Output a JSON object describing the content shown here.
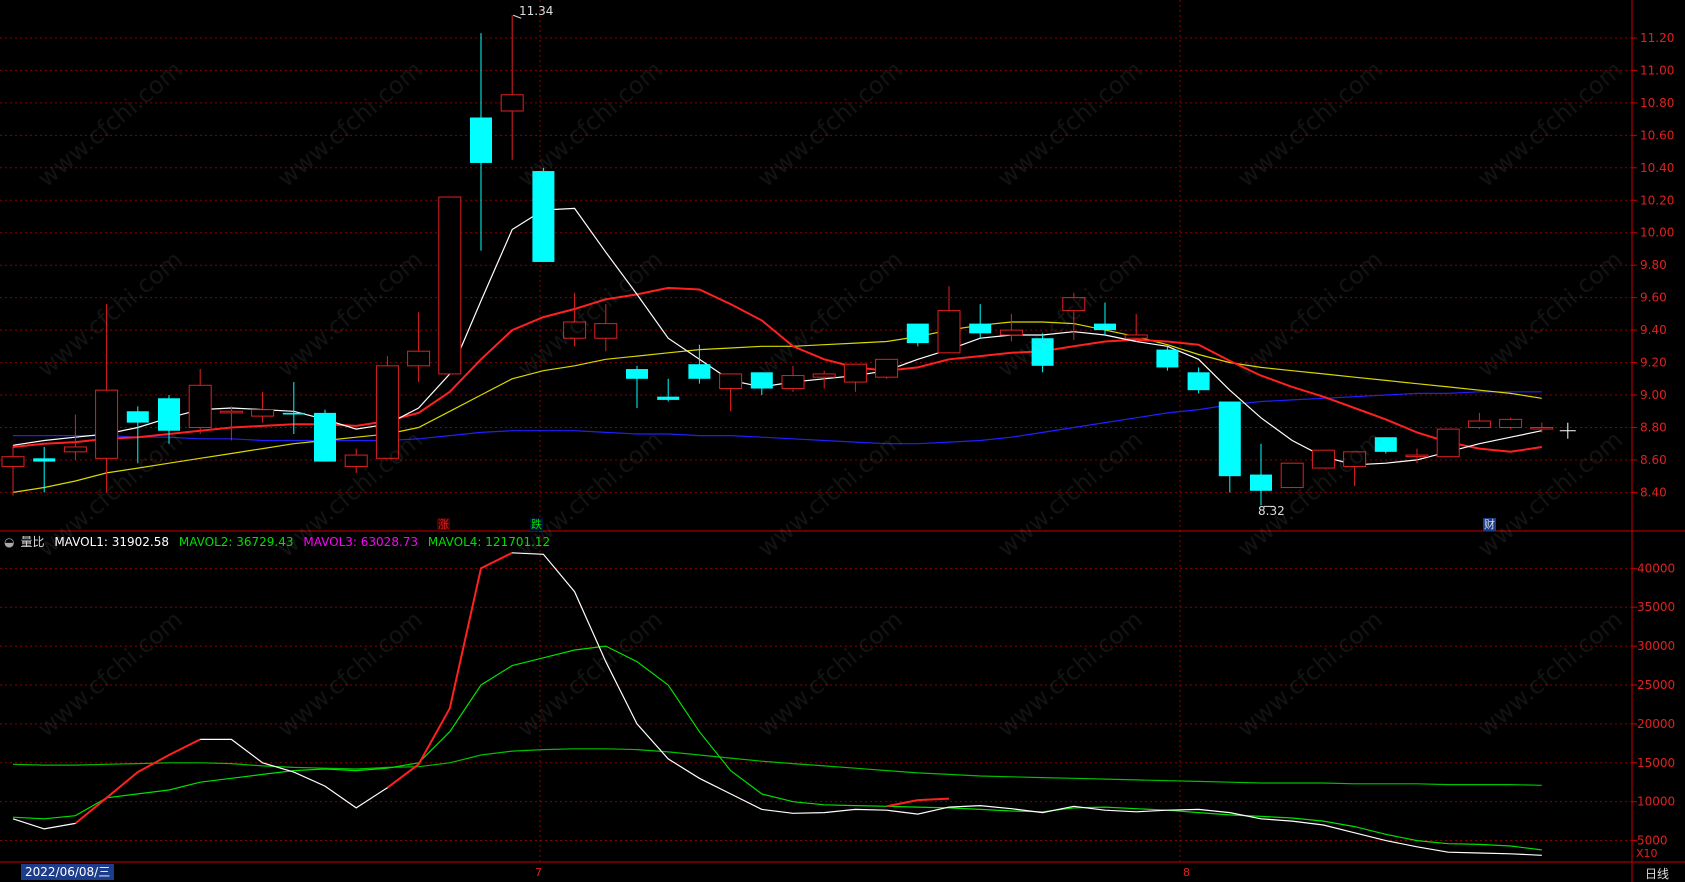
{
  "watermark": "www.cfchi.com",
  "colors": {
    "up": "#e02020",
    "down": "#00ffff",
    "ma5": "#ffffff",
    "ma10": "#ff2020",
    "ma20": "#d8d800",
    "ma60": "#2020ff",
    "mavol1": "#ffffff",
    "mavol2": "#00e000",
    "mavol3": "#ff00ff",
    "mavol4": "#00c000",
    "grid": "#8b0000",
    "axis": "#cc0000"
  },
  "price_axis": {
    "ticks": [
      "11.20",
      "11.00",
      "10.80",
      "10.60",
      "10.40",
      "10.20",
      "10.00",
      "9.80",
      "9.60",
      "9.40",
      "9.20",
      "9.00",
      "8.80",
      "8.60",
      "8.40"
    ],
    "min": 8.23,
    "max": 11.36
  },
  "volume_axis": {
    "ticks": [
      "40000",
      "35000",
      "30000",
      "25000",
      "20000",
      "15000",
      "10000",
      "5000"
    ],
    "unit": "X10",
    "min": 2500,
    "max": 43000
  },
  "annotations": {
    "high": "11.34",
    "low": "8.32"
  },
  "markers": {
    "zhang": "涨",
    "die": "跌",
    "cai": "财"
  },
  "volume_legend": {
    "name": "量比",
    "mavol1": "MAVOL1: 31902.58",
    "mavol2": "MAVOL2: 36729.43",
    "mavol3": "MAVOL3: 63028.73",
    "mavol4": "MAVOL4: 121701.12"
  },
  "bottom_bar": {
    "date": "2022/06/08/三",
    "months": [
      "7",
      "8"
    ],
    "period": "日线"
  },
  "chart_data": {
    "type": "candlestick",
    "candles": [
      {
        "o": 8.56,
        "c": 8.62,
        "h": 8.69,
        "l": 8.38
      },
      {
        "o": 8.61,
        "c": 8.59,
        "h": 8.68,
        "l": 8.4
      },
      {
        "o": 8.65,
        "c": 8.68,
        "h": 8.88,
        "l": 8.6
      },
      {
        "o": 8.61,
        "c": 9.03,
        "h": 9.56,
        "l": 8.4
      },
      {
        "o": 8.9,
        "c": 8.83,
        "h": 8.93,
        "l": 8.58
      },
      {
        "o": 8.98,
        "c": 8.78,
        "h": 9.0,
        "l": 8.7
      },
      {
        "o": 8.8,
        "c": 9.06,
        "h": 9.16,
        "l": 8.76
      },
      {
        "o": 8.89,
        "c": 8.9,
        "h": 8.93,
        "l": 8.72
      },
      {
        "o": 8.87,
        "c": 8.91,
        "h": 9.02,
        "l": 8.83
      },
      {
        "o": 8.89,
        "c": 8.88,
        "h": 9.08,
        "l": 8.76
      },
      {
        "o": 8.89,
        "c": 8.59,
        "h": 8.91,
        "l": 8.59
      },
      {
        "o": 8.56,
        "c": 8.63,
        "h": 8.67,
        "l": 8.52
      },
      {
        "o": 8.61,
        "c": 9.18,
        "h": 9.24,
        "l": 8.61
      },
      {
        "o": 9.18,
        "c": 9.27,
        "h": 9.51,
        "l": 9.08
      },
      {
        "o": 9.13,
        "c": 10.22,
        "h": 10.22,
        "l": 9.13
      },
      {
        "o": 10.71,
        "c": 10.43,
        "h": 11.23,
        "l": 9.89
      },
      {
        "o": 10.75,
        "c": 10.85,
        "h": 11.34,
        "l": 10.45
      },
      {
        "o": 10.38,
        "c": 9.82,
        "h": 10.4,
        "l": 9.82
      },
      {
        "o": 9.35,
        "c": 9.45,
        "h": 9.63,
        "l": 9.3
      },
      {
        "o": 9.35,
        "c": 9.44,
        "h": 9.56,
        "l": 9.27
      },
      {
        "o": 9.16,
        "c": 9.1,
        "h": 9.18,
        "l": 8.92
      },
      {
        "o": 8.99,
        "c": 8.97,
        "h": 9.1,
        "l": 8.96
      },
      {
        "o": 9.19,
        "c": 9.1,
        "h": 9.31,
        "l": 9.07
      },
      {
        "o": 9.04,
        "c": 9.13,
        "h": 9.13,
        "l": 8.9
      },
      {
        "o": 9.14,
        "c": 9.04,
        "h": 9.14,
        "l": 9.0
      },
      {
        "o": 9.04,
        "c": 9.12,
        "h": 9.18,
        "l": 9.02
      },
      {
        "o": 9.11,
        "c": 9.13,
        "h": 9.15,
        "l": 9.04
      },
      {
        "o": 9.08,
        "c": 9.19,
        "h": 9.19,
        "l": 9.02
      },
      {
        "o": 9.11,
        "c": 9.22,
        "h": 9.22,
        "l": 9.1
      },
      {
        "o": 9.44,
        "c": 9.32,
        "h": 9.44,
        "l": 9.3
      },
      {
        "o": 9.26,
        "c": 9.52,
        "h": 9.67,
        "l": 9.26
      },
      {
        "o": 9.44,
        "c": 9.38,
        "h": 9.56,
        "l": 9.35
      },
      {
        "o": 9.37,
        "c": 9.4,
        "h": 9.5,
        "l": 9.33
      },
      {
        "o": 9.35,
        "c": 9.18,
        "h": 9.38,
        "l": 9.14
      },
      {
        "o": 9.52,
        "c": 9.6,
        "h": 9.63,
        "l": 9.34
      },
      {
        "o": 9.44,
        "c": 9.4,
        "h": 9.57,
        "l": 9.37
      },
      {
        "o": 9.35,
        "c": 9.37,
        "h": 9.5,
        "l": 9.33
      },
      {
        "o": 9.28,
        "c": 9.17,
        "h": 9.3,
        "l": 9.15
      },
      {
        "o": 9.14,
        "c": 9.03,
        "h": 9.17,
        "l": 9.01
      },
      {
        "o": 8.96,
        "c": 8.5,
        "h": 8.96,
        "l": 8.4
      },
      {
        "o": 8.51,
        "c": 8.41,
        "h": 8.7,
        "l": 8.32
      },
      {
        "o": 8.43,
        "c": 8.58,
        "h": 8.58,
        "l": 8.43
      },
      {
        "o": 8.55,
        "c": 8.66,
        "h": 8.66,
        "l": 8.55
      },
      {
        "o": 8.56,
        "c": 8.65,
        "h": 8.65,
        "l": 8.44
      },
      {
        "o": 8.74,
        "c": 8.65,
        "h": 8.74,
        "l": 8.64
      },
      {
        "o": 8.63,
        "c": 8.63,
        "h": 8.67,
        "l": 8.58
      },
      {
        "o": 8.62,
        "c": 8.79,
        "h": 8.79,
        "l": 8.62
      },
      {
        "o": 8.8,
        "c": 8.84,
        "h": 8.89,
        "l": 8.79
      },
      {
        "o": 8.8,
        "c": 8.85,
        "h": 8.86,
        "l": 8.79
      },
      {
        "o": 8.8,
        "c": 8.8,
        "h": 8.83,
        "l": 8.77
      }
    ],
    "ma5": [
      8.69,
      8.72,
      8.74,
      8.76,
      8.8,
      8.86,
      8.91,
      8.92,
      8.91,
      8.9,
      8.85,
      8.79,
      8.82,
      8.92,
      9.13,
      9.58,
      10.02,
      10.14,
      10.15,
      9.88,
      9.62,
      9.35,
      9.22,
      9.09,
      9.05,
      9.08,
      9.1,
      9.12,
      9.15,
      9.22,
      9.28,
      9.35,
      9.37,
      9.37,
      9.39,
      9.37,
      9.33,
      9.3,
      9.22,
      9.03,
      8.86,
      8.72,
      8.62,
      8.57,
      8.58,
      8.6,
      8.65,
      8.7,
      8.74,
      8.78
    ],
    "ma10": [
      8.68,
      8.7,
      8.71,
      8.73,
      8.74,
      8.76,
      8.78,
      8.8,
      8.81,
      8.82,
      8.82,
      8.81,
      8.84,
      8.89,
      9.02,
      9.22,
      9.4,
      9.48,
      9.53,
      9.59,
      9.62,
      9.66,
      9.65,
      9.56,
      9.46,
      9.3,
      9.22,
      9.17,
      9.15,
      9.17,
      9.22,
      9.24,
      9.26,
      9.27,
      9.3,
      9.33,
      9.34,
      9.33,
      9.31,
      9.21,
      9.12,
      9.05,
      8.99,
      8.92,
      8.85,
      8.77,
      8.71,
      8.67,
      8.65,
      8.68
    ],
    "ma20": [
      8.4,
      8.43,
      8.47,
      8.52,
      8.55,
      8.58,
      8.61,
      8.64,
      8.67,
      8.7,
      8.72,
      8.74,
      8.76,
      8.8,
      8.9,
      9.0,
      9.1,
      9.15,
      9.18,
      9.22,
      9.24,
      9.26,
      9.28,
      9.29,
      9.3,
      9.3,
      9.31,
      9.32,
      9.33,
      9.36,
      9.4,
      9.43,
      9.45,
      9.45,
      9.44,
      9.4,
      9.36,
      9.31,
      9.25,
      9.2,
      9.17,
      9.15,
      9.13,
      9.11,
      9.09,
      9.07,
      9.05,
      9.03,
      9.01,
      8.98
    ],
    "ma60": [
      8.75,
      8.75,
      8.75,
      8.75,
      8.74,
      8.74,
      8.73,
      8.73,
      8.72,
      8.72,
      8.72,
      8.72,
      8.72,
      8.73,
      8.75,
      8.77,
      8.78,
      8.78,
      8.78,
      8.77,
      8.76,
      8.76,
      8.75,
      8.75,
      8.74,
      8.73,
      8.72,
      8.71,
      8.7,
      8.7,
      8.71,
      8.72,
      8.74,
      8.77,
      8.8,
      8.83,
      8.86,
      8.89,
      8.91,
      8.94,
      8.96,
      8.97,
      8.98,
      8.99,
      9.0,
      9.01,
      9.01,
      9.02,
      9.02,
      9.02
    ],
    "mavol1": [
      7800,
      6500,
      7200,
      10500,
      13800,
      16000,
      18000,
      18000,
      15000,
      13800,
      12000,
      9200,
      11800,
      14800,
      22000,
      40000,
      42000,
      41800,
      37000,
      28000,
      20000,
      15500,
      13000,
      11000,
      9000,
      8500,
      8600,
      9000,
      8900,
      8400,
      9300,
      9500,
      9100,
      8600,
      9400,
      8900,
      8700,
      8900,
      9000,
      8600,
      7800,
      7500,
      7000,
      6000,
      5000,
      4200,
      3500,
      3400,
      3300,
      3100
    ],
    "mavol2": [
      8000,
      7800,
      8200,
      10500,
      11000,
      11500,
      12500,
      13000,
      13500,
      14000,
      14200,
      14000,
      14300,
      15000,
      19000,
      25000,
      27500,
      28500,
      29500,
      30000,
      28000,
      25000,
      19000,
      14000,
      11000,
      10000,
      9600,
      9500,
      9400,
      9300,
      9200,
      9000,
      8800,
      8700,
      9200,
      9300,
      9100,
      8900,
      8600,
      8300,
      8100,
      7900,
      7500,
      6800,
      5800,
      5000,
      4600,
      4500,
      4300,
      3800
    ],
    "mavol3": [
      null,
      null,
      null,
      null,
      null,
      null,
      null,
      null,
      null,
      null,
      null,
      null,
      null,
      null,
      null,
      null,
      null,
      null,
      null,
      null,
      null,
      null,
      null,
      null,
      null,
      null,
      null,
      null,
      9400,
      10200,
      10400,
      null,
      null,
      null,
      null,
      null,
      null,
      null,
      null,
      null,
      null,
      null,
      null,
      null,
      null,
      null,
      null,
      null,
      null,
      null
    ],
    "mavol4": [
      14800,
      14700,
      14700,
      14800,
      14900,
      15000,
      15000,
      14900,
      14600,
      14400,
      14300,
      14200,
      14400,
      14500,
      15000,
      16000,
      16500,
      16700,
      16800,
      16800,
      16700,
      16400,
      16000,
      15600,
      15200,
      14900,
      14600,
      14300,
      14000,
      13700,
      13500,
      13300,
      13200,
      13100,
      13000,
      12900,
      12800,
      12700,
      12600,
      12500,
      12400,
      12400,
      12400,
      12300,
      12300,
      12300,
      12200,
      12200,
      12200,
      12100
    ]
  }
}
